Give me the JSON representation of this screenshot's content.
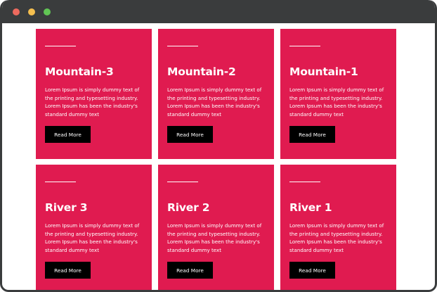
{
  "window": {
    "controls": {
      "close_color": "#ed6a5e",
      "minimize_color": "#f5bf4f",
      "maximize_color": "#61c554"
    }
  },
  "theme": {
    "card_color": "#e01b50",
    "button_color": "#000000",
    "frame_color": "#3a3c3d"
  },
  "cards": [
    {
      "title": "Mountain-3",
      "description": "Lorem Ipsum is simply dummy text of the printing and typesetting industry. Lorem Ipsum has been the industry's standard dummy text",
      "button": "Read More"
    },
    {
      "title": "Mountain-2",
      "description": "Lorem Ipsum is simply dummy text of the printing and typesetting industry. Lorem Ipsum has been the industry's standard dummy text",
      "button": "Read More"
    },
    {
      "title": "Mountain-1",
      "description": "Lorem Ipsum is simply dummy text of the printing and typesetting industry. Lorem Ipsum has been the industry's standard dummy text",
      "button": "Read More"
    },
    {
      "title": "River 3",
      "description": "Lorem Ipsum is simply dummy text of the printing and typesetting industry. Lorem Ipsum has been the industry's standard dummy text",
      "button": "Read More"
    },
    {
      "title": "River 2",
      "description": "Lorem Ipsum is simply dummy text of the printing and typesetting industry. Lorem Ipsum has been the industry's standard dummy text",
      "button": "Read More"
    },
    {
      "title": "River 1",
      "description": "Lorem Ipsum is simply dummy text of the printing and typesetting industry. Lorem Ipsum has been the industry's standard dummy text",
      "button": "Read More"
    }
  ]
}
